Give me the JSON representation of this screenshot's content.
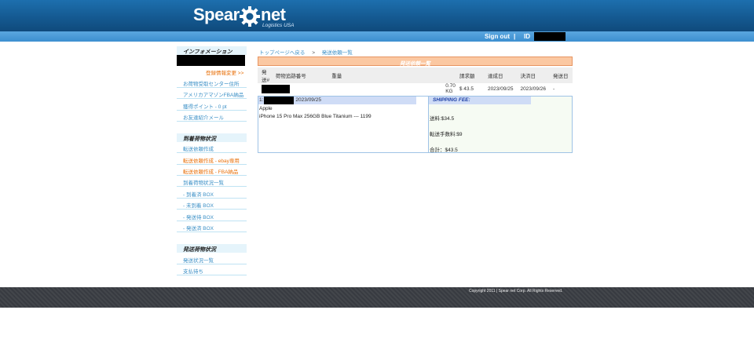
{
  "header": {
    "logo_word_left": "Spear",
    "logo_word_right": "net",
    "logo_subtitle": "Logistics USA",
    "signout_label": "Sign out",
    "separator": "|",
    "id_label": "ID"
  },
  "sidebar": {
    "info_heading": "インフォメーション",
    "info_change_link": "登録情報変更 >>",
    "info_links": [
      "お荷物受取センター住所",
      "アメリカアマゾンFBA納品",
      "獲得ポイント - 0 pt",
      "お友達紹介メール"
    ],
    "arrival_heading": "到着荷物状況",
    "arrival_links": [
      {
        "label": "転送依頼作成",
        "color": "blue"
      },
      {
        "label": "転送依頼作成 - ebay専用",
        "color": "orange"
      },
      {
        "label": "転送依頼作成 - FBA納品",
        "color": "orange"
      },
      {
        "label": "到着荷物状況一覧",
        "color": "blue"
      },
      {
        "label": "- 到着済 BOX",
        "color": "blue"
      },
      {
        "label": "- 未到着 BOX",
        "color": "blue"
      },
      {
        "label": "- 発送待 BOX",
        "color": "blue"
      },
      {
        "label": "- 発送済 BOX",
        "color": "blue"
      }
    ],
    "shipping_heading": "発送荷物状況",
    "shipping_links": [
      "発送状況一覧",
      "支払待ち"
    ]
  },
  "breadcrumb": {
    "home": "トップページへ戻る",
    "arrow": ">",
    "current": "発送依頼一覧"
  },
  "shipping_list": {
    "title": "発送依頼一覧",
    "columns": [
      "発送#",
      "荷物追跡番号",
      "重量",
      "請求額",
      "達成日",
      "決済日",
      "発送日"
    ],
    "rows": [
      {
        "weight": "0.70 KG",
        "amount": "$ 43.5",
        "completed": "2023/09/25",
        "paid": "2023/09/26",
        "shipped": "-"
      }
    ]
  },
  "order_detail": {
    "prefix": "1:",
    "date": "2023/09/25",
    "brand": "Apple",
    "product": "iPhone 15 Pro Max 256GB Blue Titanium --- 1199",
    "fee_heading": "SHIPPING FEE:",
    "shipping_fee": "送料:$34.5",
    "forwarding_fee": "転送手数料:$9",
    "total": "合計：$43.5"
  },
  "footer": {
    "copyright": "Copyright 2011 | Spear net Corp. All Rights Reserved."
  },
  "colors": {
    "header_blue": "#14588f",
    "topbar_blue": "#3c8fd0",
    "link_blue": "#3a8fc6",
    "accent_orange": "#e8700a",
    "list_title_bg": "#fbc8a2",
    "footer_bg": "#3b3e44"
  }
}
